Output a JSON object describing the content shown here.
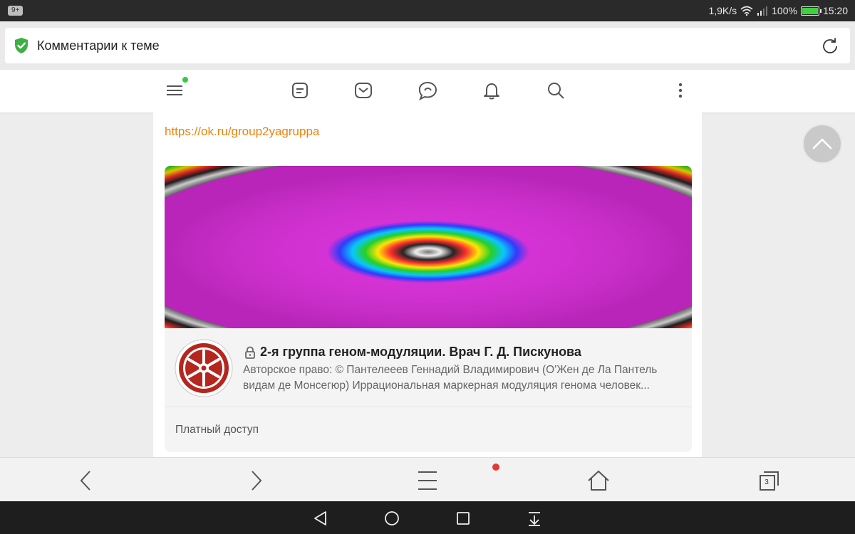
{
  "status_bar": {
    "notification_badge": "9+",
    "network_speed": "1,9K/s",
    "battery_percent": "100%",
    "time": "15:20"
  },
  "address_bar": {
    "title": "Комментарии к теме"
  },
  "top_nav": {
    "icons": [
      "menu-icon",
      "notes-icon",
      "mail-icon",
      "chat-icon",
      "bell-icon",
      "search-icon",
      "more-icon"
    ]
  },
  "content": {
    "link_text": "https://ok.ru/group2yagruppa",
    "share_card": {
      "group_title": "2-я группа геном-модуляции. Врач Г. Д. Пискунова",
      "description": "Авторское право: © Пантелееев Геннадий Владимирович (О'Жен де Ла Пантель видам де Монсегюр) Иррациональная маркерная модуляция генома человек...",
      "access_label": "Платный доступ"
    }
  },
  "bottom_bar": {
    "tabs_count": "3"
  },
  "colors": {
    "accent_orange": "#ee8208",
    "shield_green": "#3cb043",
    "notification_dot_red": "#e53935",
    "menu_dot_green": "#2ecc40"
  }
}
